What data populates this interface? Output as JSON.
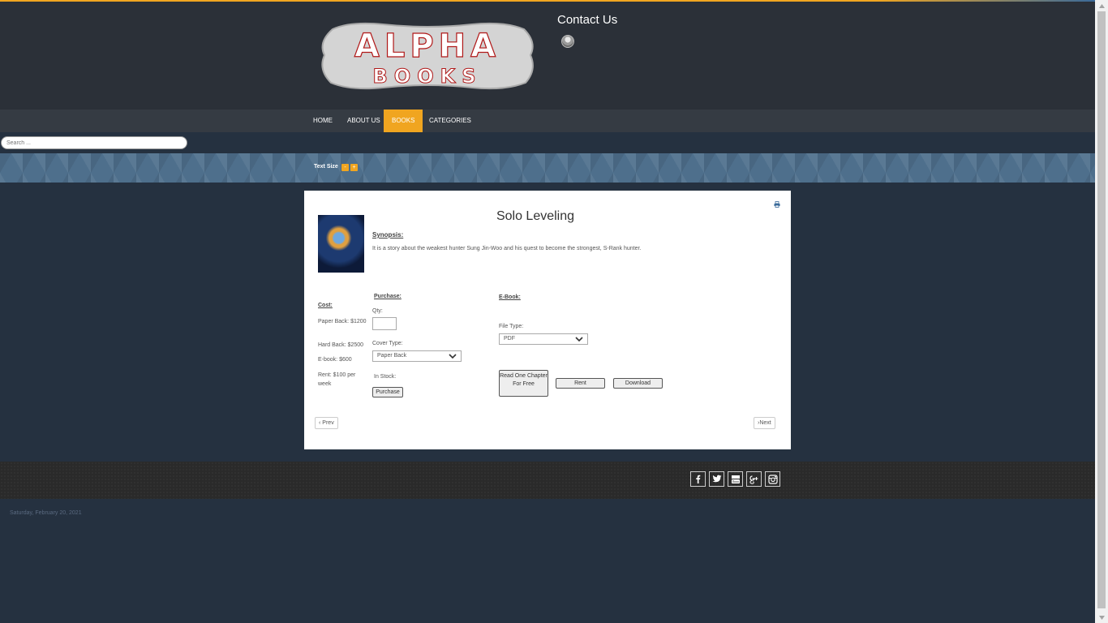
{
  "header": {
    "contact_label": "Contact Us",
    "logo_text": {
      "line1": "ALPHA",
      "line2": "BOOKS"
    }
  },
  "nav": {
    "items": [
      {
        "label": "HOME",
        "active": false
      },
      {
        "label": "ABOUT US",
        "active": false
      },
      {
        "label": "BOOKS",
        "active": true
      },
      {
        "label": "CATEGORIES",
        "active": false
      }
    ]
  },
  "search": {
    "placeholder": "Search ..."
  },
  "text_size": {
    "label": "Text Size",
    "decrease": "-",
    "increase": "+"
  },
  "book": {
    "title": "Solo Leveling",
    "synopsis_heading": "Synopsis:",
    "synopsis": "It is a story about the weakest hunter Sung Jin-Woo and his quest to become the strongest, S-Rank hunter."
  },
  "cost": {
    "heading": "Cost:",
    "paperback": "Paper Back: $1200",
    "hardback": "Hard Back: $2500",
    "ebook": "E-book: $600",
    "rent": "Rent: $100 per week"
  },
  "purchase": {
    "heading": "Purchase:",
    "qty_label": "Qty:",
    "qty_value": "",
    "cover_label": "Cover Type:",
    "cover_value": "Paper Back",
    "stock_label": "In Stock:",
    "button": "Purchase"
  },
  "ebook": {
    "heading": "E-Book:",
    "file_label": "File Type:",
    "file_value": "PDF",
    "read_button": "Read One Chapter For Free",
    "rent_button": "Rent",
    "download_button": "Download"
  },
  "pager": {
    "prev": "Prev",
    "next": "Next"
  },
  "footer": {
    "date": "Saturday, February 20, 2021",
    "social": [
      "facebook-icon",
      "twitter-icon",
      "youtube-icon",
      "google-plus-icon",
      "instagram-icon"
    ]
  },
  "colors": {
    "accent": "#f0a520",
    "background": "#253140",
    "header": "#2b3038"
  }
}
